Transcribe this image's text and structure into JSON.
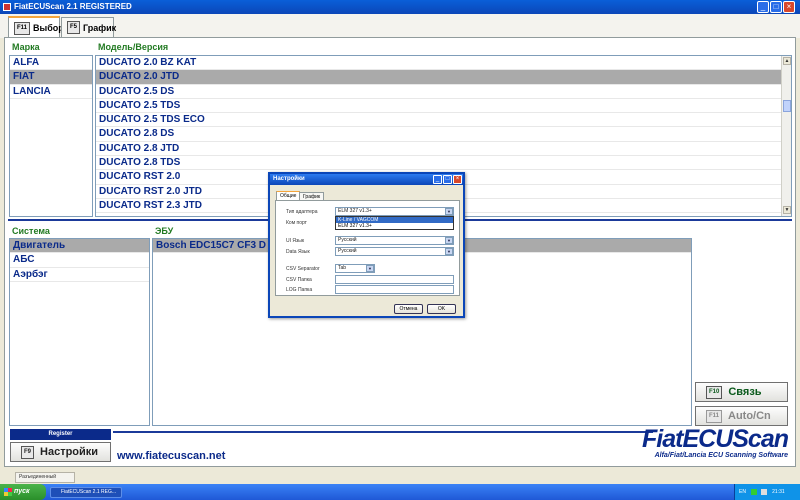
{
  "window": {
    "title": "FiatECUScan 2.1 REGISTERED"
  },
  "tabs": [
    {
      "key": "F11",
      "label": "Выбор"
    },
    {
      "key": "F5",
      "label": "График"
    }
  ],
  "make": {
    "header": "Марка",
    "items": [
      "ALFA",
      "FIAT",
      "LANCIA"
    ],
    "selected": "FIAT"
  },
  "model": {
    "header": "Модель/Версия",
    "items": [
      "DUCATO 2.0 BZ KAT",
      "DUCATO 2.0 JTD",
      "DUCATO 2.5 DS",
      "DUCATO 2.5 TDS",
      "DUCATO 2.5 TDS ECO",
      "DUCATO 2.8 DS",
      "DUCATO 2.8 JTD",
      "DUCATO 2.8 TDS",
      "DUCATO RST 2.0",
      "DUCATO RST 2.0 JTD",
      "DUCATO RST 2.3 JTD"
    ],
    "selected": "DUCATO 2.0 JTD"
  },
  "system": {
    "header": "Система",
    "items": [
      "Двигатель",
      "АБС",
      "Аэрбэг"
    ],
    "selected": "Двигатель"
  },
  "ecu": {
    "header": "ЭБУ",
    "items": [
      "Bosch EDC15C7 CF3 D"
    ],
    "selected": "Bosch EDC15C7 CF3 D"
  },
  "buttons": {
    "connect": {
      "key": "F10",
      "label": "Связь"
    },
    "auto": {
      "key": "F11",
      "label": "Auto/Cn"
    },
    "settings": {
      "key": "F9",
      "label": "Настройки"
    },
    "register": "Register"
  },
  "footer": {
    "url": "www.fiatecuscan.net",
    "logo": "FiatECUScan",
    "tagline": "Alfa/Fiat/Lancia ECU Scanning Software"
  },
  "dialog": {
    "title": "Настройки",
    "tabs": [
      "Общие",
      "График"
    ],
    "fields": {
      "adapter_label": "Тип адаптера",
      "adapter_value": "ELM 327 v1.3+",
      "adapter_options": [
        "K-Line / VAGCOM",
        "ELM 327 v1.3+"
      ],
      "port_label": "Ком порт",
      "ui_lang_label": "UI Язык",
      "ui_lang_value": "Русский",
      "data_lang_label": "Data Язык",
      "data_lang_value": "Русский",
      "csv_sep_label": "CSV Separator",
      "csv_sep_value": "Tab",
      "csv_folder_label": "CSV Папка",
      "log_folder_label": "LOG Папка"
    },
    "cancel": "Отмена",
    "ok": "OK"
  },
  "status": {
    "text": "Разъединенный"
  },
  "taskbar": {
    "start": "пуск",
    "item": "FiatECUScan 2.1 REG...",
    "lang": "EN",
    "time": "21:31"
  },
  "colors": {
    "accent": "#227a22",
    "selection": "#aaaaaa",
    "text_blue": "#0a2a8a",
    "xp_blue": "#0b46b8"
  }
}
